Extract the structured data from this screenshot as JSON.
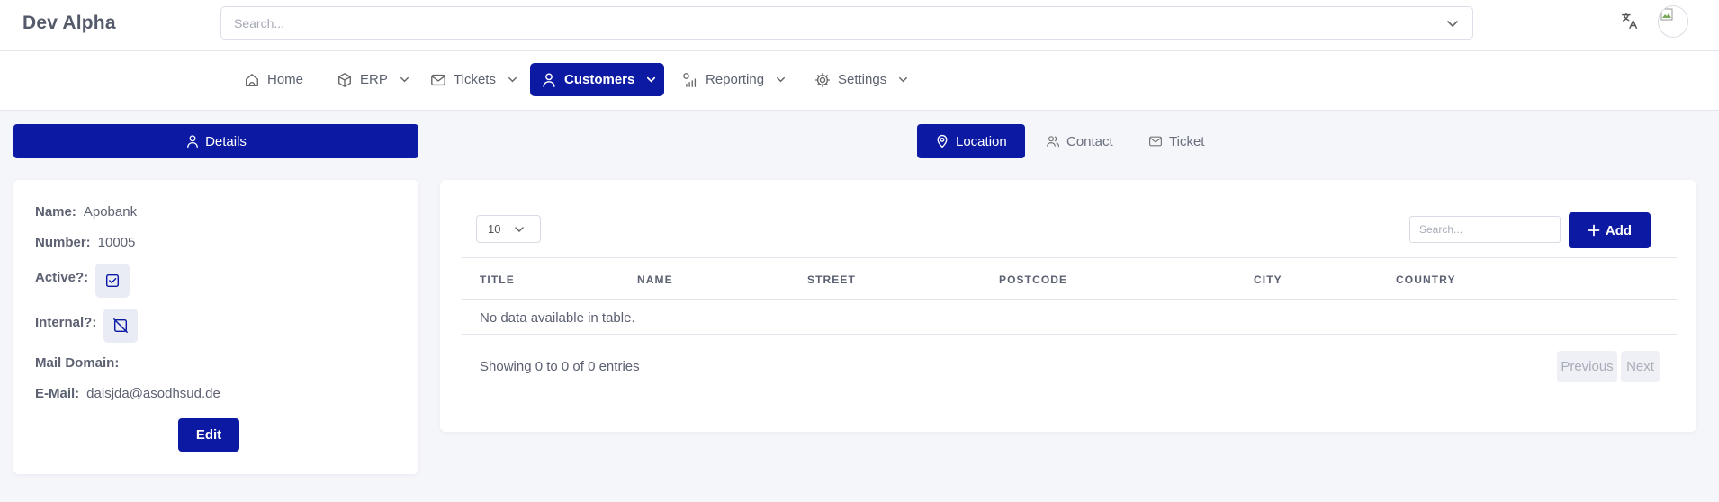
{
  "header": {
    "brand": "Dev Alpha",
    "search_placeholder": "Search...",
    "translate_icon": "translate-icon",
    "avatar_icon": "broken-image-icon"
  },
  "nav": {
    "items": [
      {
        "label": "Home",
        "icon": "home-icon",
        "has_dropdown": false
      },
      {
        "label": "ERP",
        "icon": "box-icon",
        "has_dropdown": true
      },
      {
        "label": "Tickets",
        "icon": "mail-icon",
        "has_dropdown": true
      },
      {
        "label": "Customers",
        "icon": "user-icon",
        "has_dropdown": true,
        "active": true
      },
      {
        "label": "Reporting",
        "icon": "chart-icon",
        "has_dropdown": true
      },
      {
        "label": "Settings",
        "icon": "gear-icon",
        "has_dropdown": true
      }
    ]
  },
  "details_button": {
    "label": "Details",
    "icon": "user-icon"
  },
  "tabs": [
    {
      "label": "Location",
      "icon": "map-pin-icon",
      "active": true
    },
    {
      "label": "Contact",
      "icon": "users-icon",
      "active": false
    },
    {
      "label": "Ticket",
      "icon": "mail-icon",
      "active": false
    }
  ],
  "customer": {
    "name_label": "Name:",
    "name_value": "Apobank",
    "number_label": "Number:",
    "number_value": "10005",
    "active_label": "Active?:",
    "active_checked": true,
    "internal_label": "Internal?:",
    "internal_checked": false,
    "mail_domain_label": "Mail Domain:",
    "mail_domain_value": "",
    "email_label": "E-Mail:",
    "email_value": "daisjda@asodhsud.de",
    "edit_label": "Edit"
  },
  "table": {
    "page_length": "10",
    "search_placeholder": "Search...",
    "add_label": "Add",
    "columns": [
      "TITLE",
      "NAME",
      "STREET",
      "POSTCODE",
      "CITY",
      "COUNTRY"
    ],
    "empty_message": "No data available in table.",
    "info": "Showing 0 to 0 of 0 entries",
    "prev_label": "Previous",
    "next_label": "Next"
  },
  "colors": {
    "primary": "#0c1aa3",
    "background": "#f5f6fa"
  }
}
